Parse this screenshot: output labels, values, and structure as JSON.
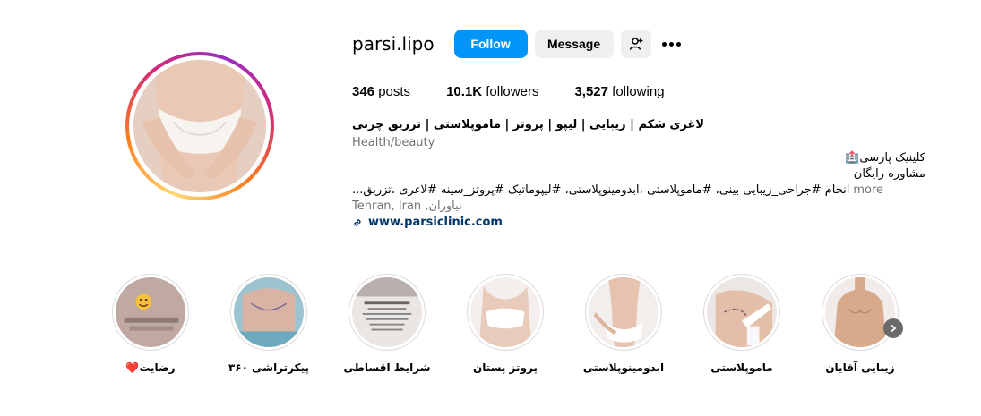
{
  "profile": {
    "username": "parsi.lipo",
    "follow_label": "Follow",
    "message_label": "Message",
    "add_user_icon": "person-add-icon",
    "more_icon": "more-options-icon"
  },
  "stats": {
    "posts_count": "346",
    "posts_label": " posts",
    "followers_count": "10.1K",
    "followers_label": " followers",
    "following_count": "3,527",
    "following_label": " following"
  },
  "bio": {
    "name": "لاغری شکم | زیبایی | لیپو | پروتز | ماموپلاستی | تزریق چربی",
    "category": "Health/beauty",
    "line1": "کلینیک پارسی🏥",
    "line2": "مشاوره رایگان",
    "description": "انجام #جراحی_زیبایی بینی، #ماموپلاستی ،ابدومینوپلاستی، #لیپوماتیک #پروتز_سینه #لاغری ،تزریق...",
    "more_label": "more",
    "location": "Tehran, Iran ,نیاوران",
    "link": "www.parsiclinic.com",
    "link_icon": "link-icon"
  },
  "highlights": [
    {
      "label": "رضایت❤️"
    },
    {
      "label": "پیکرتراشی ۳۶۰"
    },
    {
      "label": "شرایط اقساطی"
    },
    {
      "label": "پروتز پستان"
    },
    {
      "label": "ابدومینوپلاستی"
    },
    {
      "label": "ماموپلاستی"
    },
    {
      "label": "زیبایی آقایان"
    }
  ],
  "colors": {
    "primary_button": "#0095f6",
    "secondary_button": "#efefef",
    "link": "#00376b",
    "muted_text": "#737373"
  }
}
